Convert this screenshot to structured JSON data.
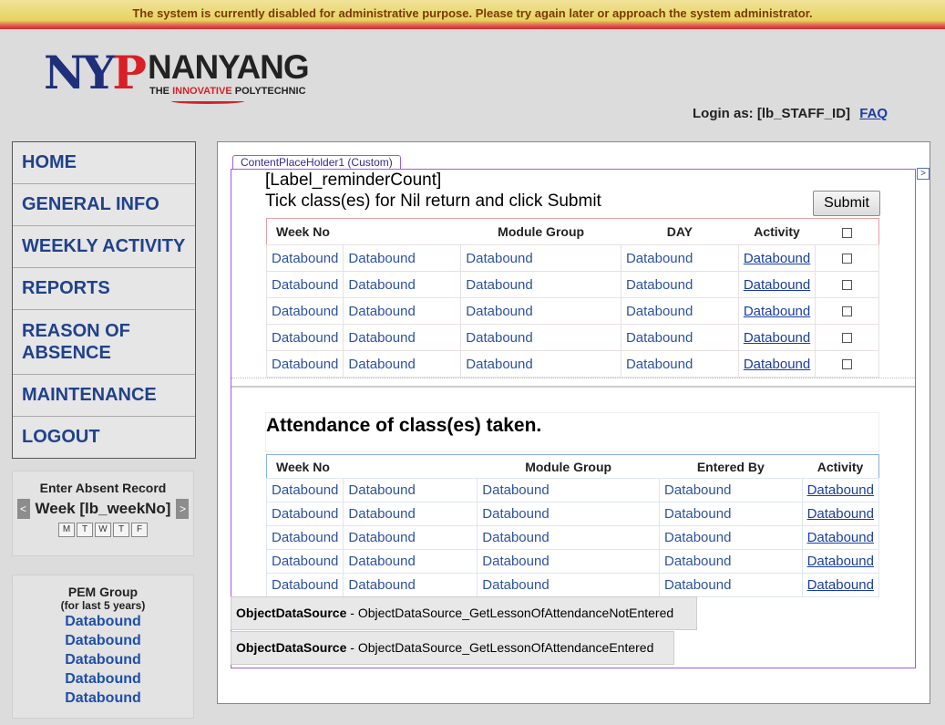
{
  "banner": "The system is currently disabled for administrative purpose. Please try again later or approach the system administrator.",
  "logo": {
    "mark_n": "N",
    "mark_y": "Y",
    "mark_p": "P",
    "name": "NANYANG",
    "tag_pre": "THE ",
    "tag_red": "INNOVATIVE",
    "tag_post": " POLYTECHNIC"
  },
  "login": {
    "label": "Login as: [lb_STAFF_ID]",
    "faq": "FAQ"
  },
  "nav": [
    "HOME",
    "GENERAL INFO",
    "WEEKLY ACTIVITY",
    "REPORTS",
    "REASON OF ABSENCE",
    "MAINTENANCE",
    "LOGOUT"
  ],
  "absent": {
    "title": "Enter Absent Record",
    "week": "Week [lb_weekNo]",
    "prev": "<",
    "next": ">",
    "days": [
      "M",
      "T",
      "W",
      "T",
      "F"
    ]
  },
  "pem": {
    "title": "PEM Group",
    "sub": "(for last 5 years)",
    "items": [
      "Databound",
      "Databound",
      "Databound",
      "Databound",
      "Databound"
    ]
  },
  "content": {
    "placeholder_tab": "ContentPlaceHolder1 (Custom)",
    "chevron": ">",
    "reminder": "[Label_reminderCount]",
    "instruction": "Tick class(es) for Nil return and click Submit",
    "submit": "Submit",
    "table1": {
      "headers": [
        "Week No",
        "Module Group",
        "DAY",
        "Activity"
      ],
      "rows": [
        [
          "Databound",
          "Databound",
          "Databound",
          "Databound",
          "Databound"
        ],
        [
          "Databound",
          "Databound",
          "Databound",
          "Databound",
          "Databound"
        ],
        [
          "Databound",
          "Databound",
          "Databound",
          "Databound",
          "Databound"
        ],
        [
          "Databound",
          "Databound",
          "Databound",
          "Databound",
          "Databound"
        ],
        [
          "Databound",
          "Databound",
          "Databound",
          "Databound",
          "Databound"
        ]
      ]
    },
    "attendance_title": "Attendance of class(es) taken.",
    "table2": {
      "headers": [
        "Week No",
        "Module Group",
        "Entered By",
        "Activity"
      ],
      "rows": [
        [
          "Databound",
          "Databound",
          "Databound",
          "Databound",
          "Databound"
        ],
        [
          "Databound",
          "Databound",
          "Databound",
          "Databound",
          "Databound"
        ],
        [
          "Databound",
          "Databound",
          "Databound",
          "Databound",
          "Databound"
        ],
        [
          "Databound",
          "Databound",
          "Databound",
          "Databound",
          "Databound"
        ],
        [
          "Databound",
          "Databound",
          "Databound",
          "Databound",
          "Databound"
        ]
      ]
    },
    "ods1": {
      "bold": "ObjectDataSource",
      "rest": " - ObjectDataSource_GetLessonOfAttendanceNotEntered"
    },
    "ods2": {
      "bold": "ObjectDataSource",
      "rest": " - ObjectDataSource_GetLessonOfAttendanceEntered"
    }
  }
}
